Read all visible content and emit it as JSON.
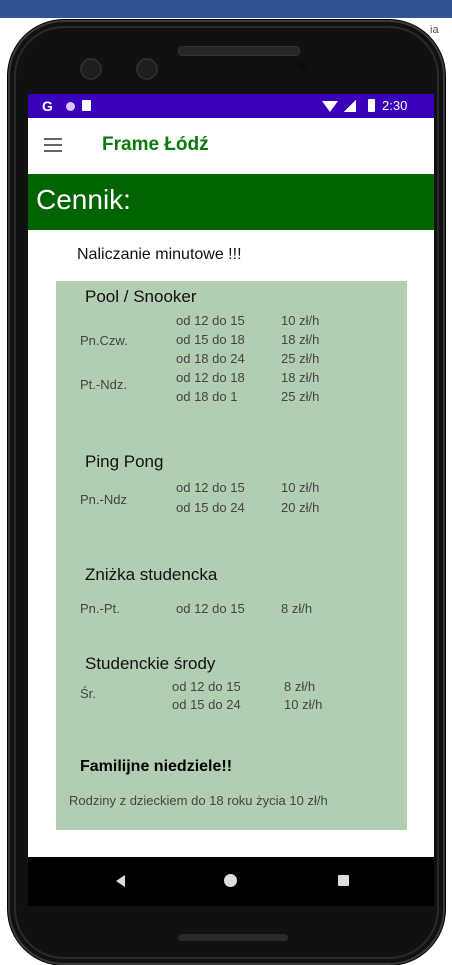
{
  "edge_text": "ia",
  "statusbar": {
    "g_label": "G",
    "time": "2:30"
  },
  "appbar": {
    "title": "Frame Łódź"
  },
  "banner": {
    "title": "Cennik:"
  },
  "notice": "Naliczanie minutowe !!!",
  "pool": {
    "title": "Pool / Snooker",
    "rows": [
      {
        "day": "Pn.Czw.",
        "hours": [
          "od 12 do 15",
          "od 15 do 18",
          "od 18 do 24"
        ],
        "prices": [
          "10 zł/h",
          "18 zł/h",
          "25 zł/h"
        ]
      },
      {
        "day": "Pt.-Ndz.",
        "hours": [
          "od 12 do 18",
          "od 18 do 1"
        ],
        "prices": [
          "18 zł/h",
          "25 zł/h"
        ]
      }
    ]
  },
  "pingpong": {
    "title": "Ping Pong",
    "day": "Pn.-Ndz",
    "hours": [
      "od 12 do 15",
      "od 15 do 24"
    ],
    "prices": [
      "10 zł/h",
      "20 zł/h"
    ]
  },
  "student_discount": {
    "title": "Zniżka studencka",
    "day": "Pn.-Pt.",
    "hours": "od 12 do 15",
    "price": "8 zł/h"
  },
  "student_wednesday": {
    "title": "Studenckie środy",
    "day": "Śr.",
    "hours": [
      "od 12 do 15",
      "od 15 do 24"
    ],
    "prices": [
      "8 zł/h",
      "10 zł/h"
    ]
  },
  "family": {
    "title": "Familijne niedziele!!",
    "text": "Rodziny z dzieckiem do 18 roku życia 10 zł/h"
  }
}
